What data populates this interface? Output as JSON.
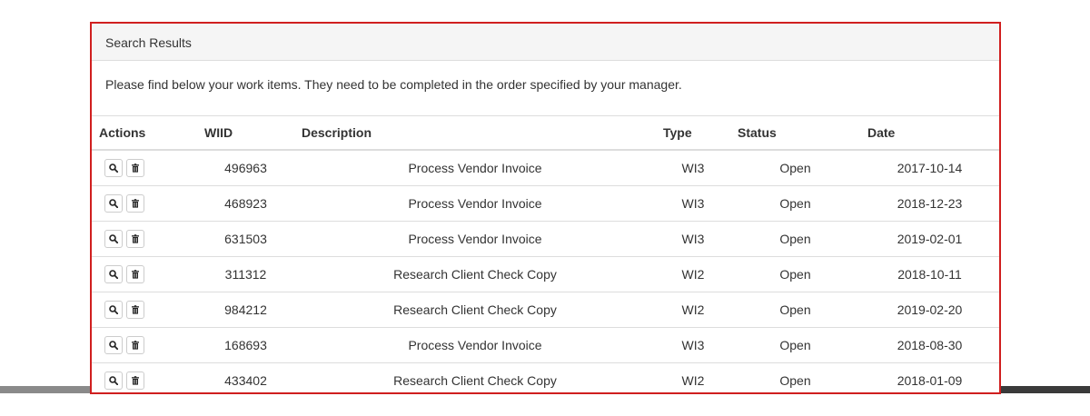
{
  "panel": {
    "heading": "Search Results",
    "instructions": "Please find below your work items. They need to be completed in the order specified by your manager."
  },
  "table": {
    "headers": {
      "actions": "Actions",
      "wiid": "WIID",
      "description": "Description",
      "type": "Type",
      "status": "Status",
      "date": "Date"
    },
    "rows": [
      {
        "wiid": "496963",
        "description": "Process Vendor Invoice",
        "type": "WI3",
        "status": "Open",
        "date": "2017-10-14"
      },
      {
        "wiid": "468923",
        "description": "Process Vendor Invoice",
        "type": "WI3",
        "status": "Open",
        "date": "2018-12-23"
      },
      {
        "wiid": "631503",
        "description": "Process Vendor Invoice",
        "type": "WI3",
        "status": "Open",
        "date": "2019-02-01"
      },
      {
        "wiid": "311312",
        "description": "Research Client Check Copy",
        "type": "WI2",
        "status": "Open",
        "date": "2018-10-11"
      },
      {
        "wiid": "984212",
        "description": "Research Client Check Copy",
        "type": "WI2",
        "status": "Open",
        "date": "2019-02-20"
      },
      {
        "wiid": "168693",
        "description": "Process Vendor Invoice",
        "type": "WI3",
        "status": "Open",
        "date": "2018-08-30"
      },
      {
        "wiid": "433402",
        "description": "Research Client Check Copy",
        "type": "WI2",
        "status": "Open",
        "date": "2018-01-09"
      }
    ]
  },
  "icons": {
    "view": "search-icon",
    "delete": "trash-icon"
  },
  "colors": {
    "highlight_border": "#d01f1f",
    "heading_bg": "#f5f5f5",
    "row_border": "#dddddd"
  }
}
